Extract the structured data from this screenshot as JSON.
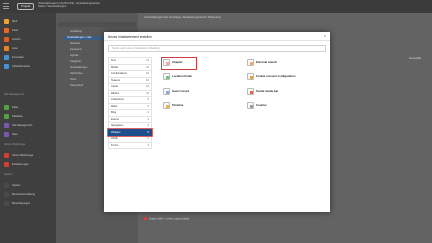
{
  "topbar": {
    "site_button": "Projekt",
    "title_line1": "Veranstaltungen [1.5] (IP.1.IP.2) - Entwicklungsversion",
    "title_line2": "Seiten / Veranstaltungen"
  },
  "sidebar": {
    "items": [
      {
        "label": "Web",
        "color": "#e8a33a"
      },
      {
        "label": "Seite",
        "color": "#e56a2d"
      },
      {
        "label": "Ansicht",
        "color": "#d6612a"
      },
      {
        "label": "Liste",
        "color": "#e0862c"
      },
      {
        "label": "Formulare",
        "color": "#4c91cf"
      },
      {
        "label": "Arbeitsbereiche",
        "color": "#4c91cf"
      },
      {
        "label": "Datei",
        "color": "#5a9e4a"
      },
      {
        "label": "Dateiliste",
        "color": "#5a9e4a"
      },
      {
        "label": "Site Management",
        "color": "#7a5aa8"
      },
      {
        "label": "Sites",
        "color": "#7a5aa8"
      },
      {
        "label": "Admin Werkzeuge",
        "color": "#c5433a"
      },
      {
        "label": "Erweiterungen",
        "color": "#c5433a"
      },
      {
        "label": "System",
        "color": "#4a4a4a"
      },
      {
        "label": "Benutzerverwaltung",
        "color": "#4a4a4a"
      },
      {
        "label": "Berechtigungen",
        "color": "#4a4a4a"
      }
    ],
    "groups": [
      "Web",
      "Site Management",
      "Datei",
      "Admin Werkzeuge",
      "System"
    ]
  },
  "tree": {
    "rows": [
      "Verwaltung",
      "Veranstaltungen - Liste",
      "Startseite",
      "Impressum",
      "Agenda",
      "Kategorien",
      "Veranstaltungen",
      "Nachrichten",
      "Home",
      "Datenschutz"
    ]
  },
  "content": {
    "crumb": "Veranstaltungen  Neu hinzufügen, Bearbeitungsbereich, Bedeutung",
    "language": "Europ(DE)",
    "bottom_element": "Image width + Lorem Layout (gelb)"
  },
  "modal": {
    "title": "Neues Inhaltselement erstellen",
    "close": "×",
    "search_placeholder": "Suche nach einem Inhaltstyp in Inhaltstyp",
    "categories": [
      {
        "label": "Text",
        "count": "13"
      },
      {
        "label": "Media",
        "count": "11"
      },
      {
        "label": "Combinations",
        "count": "10"
      },
      {
        "label": "Teasers",
        "count": "10"
      },
      {
        "label": "Cards",
        "count": "15"
      },
      {
        "label": "Ribbon",
        "count": "11"
      },
      {
        "label": "Collections",
        "count": "5"
      },
      {
        "label": "Maps",
        "count": "4"
      },
      {
        "label": "Blog",
        "count": "4"
      },
      {
        "label": "Events",
        "count": "3"
      },
      {
        "label": "Navigation",
        "count": "4"
      },
      {
        "label": "Widgets",
        "count": "8"
      },
      {
        "label": "HTML",
        "count": "2"
      },
      {
        "label": "Forms",
        "count": "4"
      }
    ],
    "elements": [
      {
        "label": "Chapter",
        "icon": "chapter-icon"
      },
      {
        "label": "Location finder",
        "icon": "location-finder-icon"
      },
      {
        "label": "Insert record",
        "icon": "insert-record-icon"
      },
      {
        "label": "Timeline",
        "icon": "timeline-icon"
      },
      {
        "label": "External search",
        "icon": "external-search-icon"
      },
      {
        "label": "Cookie consent configuration",
        "icon": "cookie-consent-icon"
      },
      {
        "label": "Social media bar",
        "icon": "social-media-icon"
      },
      {
        "label": "Counter",
        "icon": "counter-icon"
      }
    ]
  },
  "colors": {
    "accent": "#1f4e8c",
    "highlight": "#d33b3b",
    "overlay": "#5c5c5c"
  }
}
